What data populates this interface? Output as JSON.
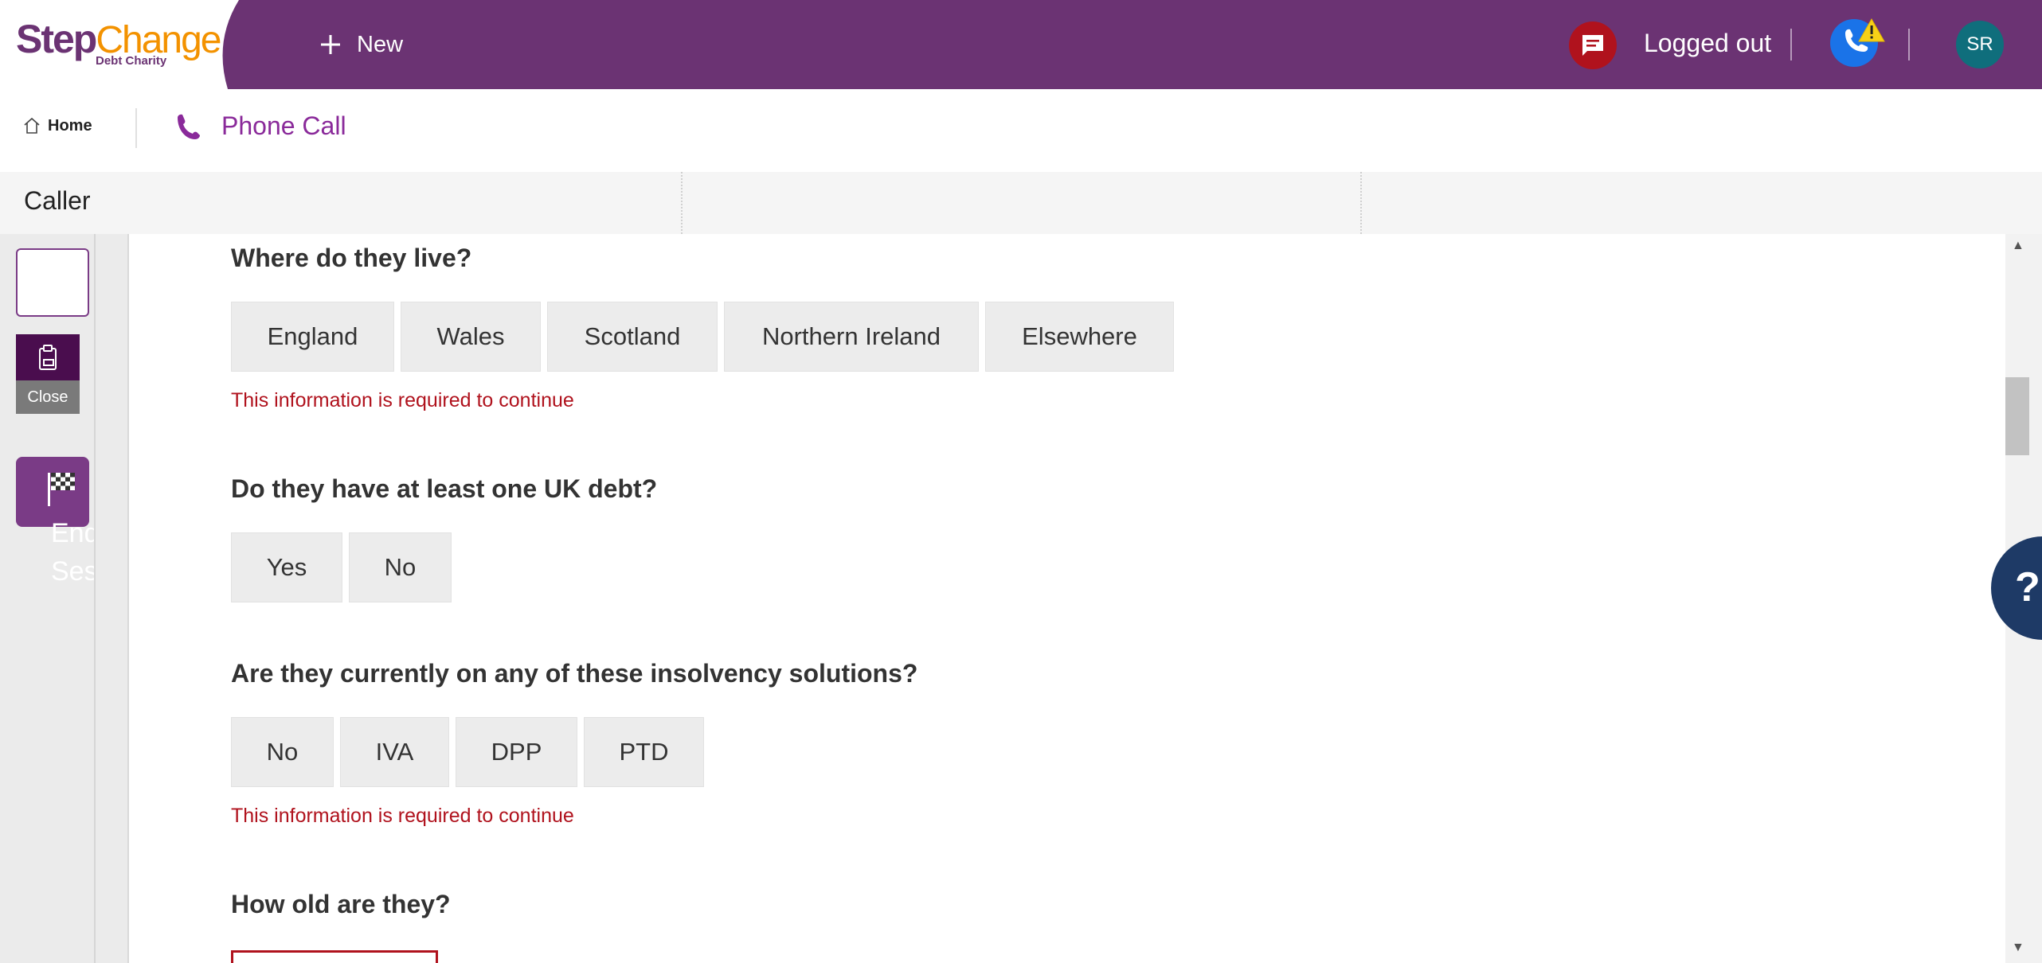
{
  "header": {
    "logo": {
      "step": "Step",
      "change": "Change",
      "subtitle": "Debt Charity"
    },
    "new_label": "New",
    "status_label": "Logged out",
    "avatar_initials": "SR",
    "colors": {
      "brand_purple": "#6b3373",
      "brand_orange": "#f39200",
      "alert_red": "#b0121d",
      "phone_blue": "#1a73e8",
      "avatar_teal": "#0f6e7c"
    }
  },
  "subnav": {
    "home_label": "Home",
    "active_tab": "Phone Call"
  },
  "caller_bar": {
    "label": "Caller"
  },
  "left_rail": {
    "close_label": "Close",
    "end_session_label": "End\nSession"
  },
  "form": {
    "q_live": {
      "title": "Where do they live?",
      "options": [
        "England",
        "Wales",
        "Scotland",
        "Northern Ireland",
        "Elsewhere"
      ],
      "error": "This information is required to continue"
    },
    "q_debt": {
      "title": "Do they have at least one UK debt?",
      "options": [
        "Yes",
        "No"
      ]
    },
    "q_insolvency": {
      "title": "Are they currently on any of these insolvency solutions?",
      "options": [
        "No",
        "IVA",
        "DPP",
        "PTD"
      ],
      "error": "This information is required to continue"
    },
    "q_age": {
      "title": "How old are they?"
    }
  },
  "help": {
    "label": "?"
  },
  "icons": [
    "plus-icon",
    "chat-icon",
    "phone-alert-icon",
    "warning-icon",
    "home-icon",
    "phone-icon",
    "clipboard-icon",
    "flag-icon",
    "help-icon"
  ]
}
